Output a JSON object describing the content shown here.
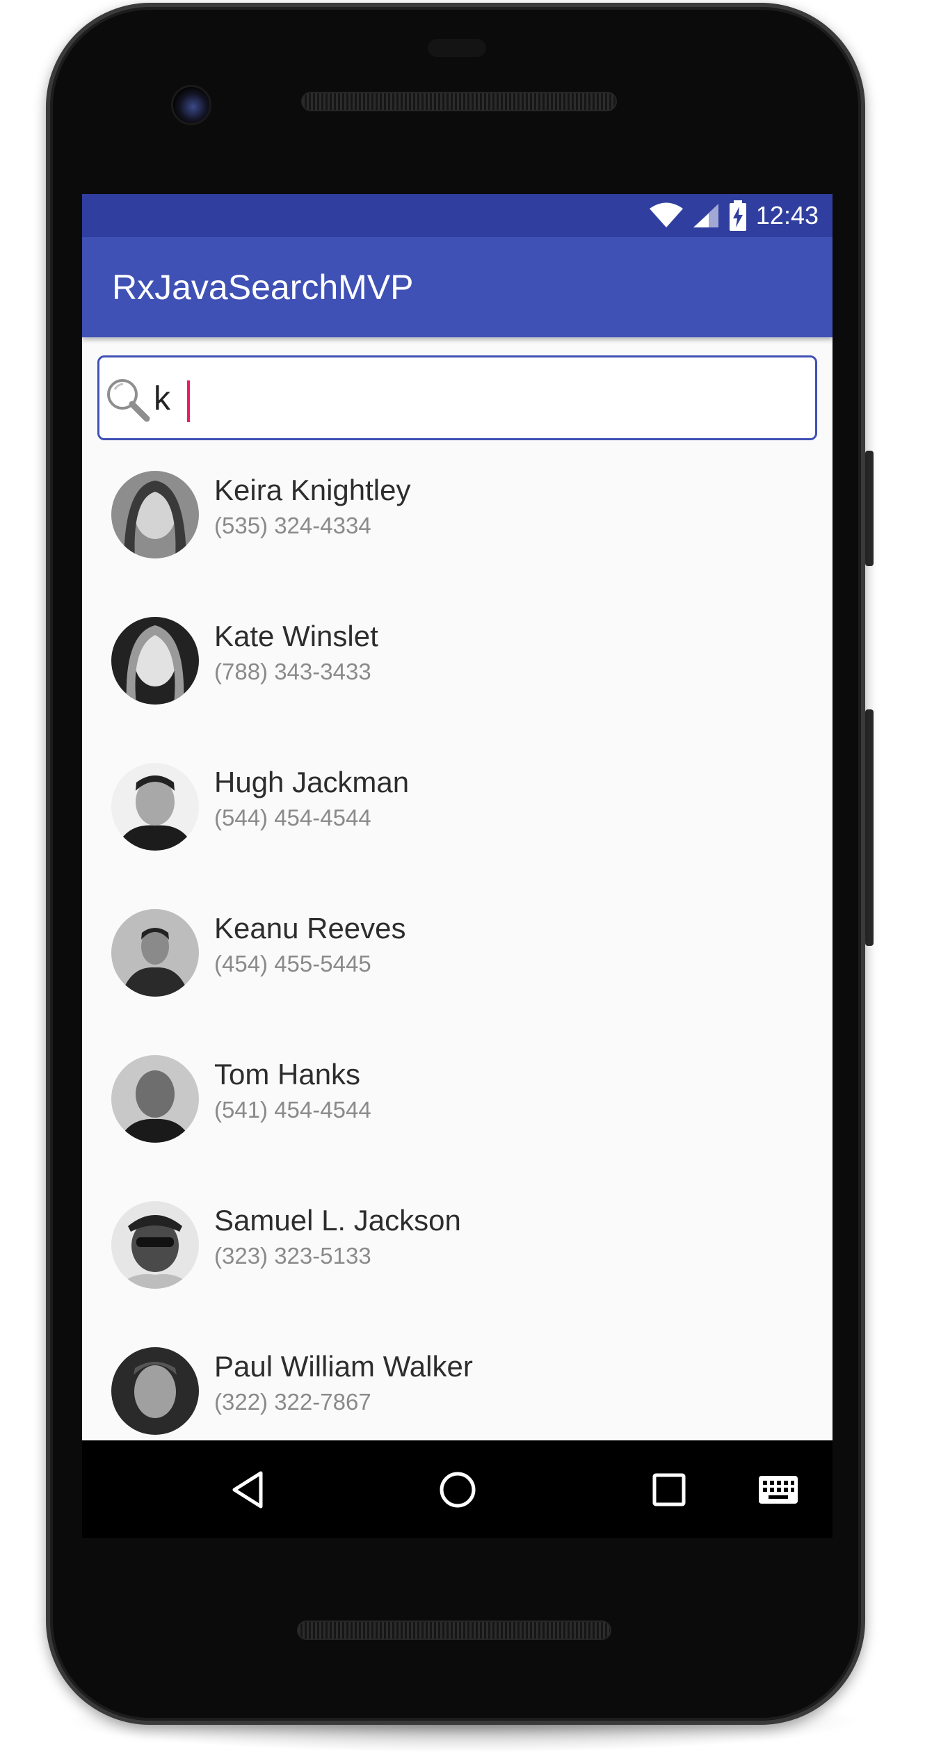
{
  "status_bar": {
    "time": "12:43"
  },
  "app_bar": {
    "title": "RxJavaSearchMVP"
  },
  "search": {
    "value": "k"
  },
  "contacts": [
    {
      "name": "Keira Knightley",
      "phone": "(535) 324-4334"
    },
    {
      "name": "Kate Winslet",
      "phone": "(788) 343-3433"
    },
    {
      "name": "Hugh Jackman",
      "phone": "(544) 454-4544"
    },
    {
      "name": "Keanu Reeves",
      "phone": "(454) 455-5445"
    },
    {
      "name": "Tom Hanks",
      "phone": "(541) 454-4544"
    },
    {
      "name": "Samuel L. Jackson",
      "phone": "(323) 323-5133"
    },
    {
      "name": "Paul William Walker",
      "phone": "(322) 322-7867"
    }
  ],
  "nav_bar": {
    "back_icon": "triangle-back-icon",
    "home_icon": "circle-home-icon",
    "recents_icon": "square-recents-icon",
    "keyboard_icon": "keyboard-icon"
  },
  "colors": {
    "status_bar": "#303f9f",
    "primary": "#3f51b5",
    "accent": "#e91e63",
    "background": "#fafafa"
  }
}
